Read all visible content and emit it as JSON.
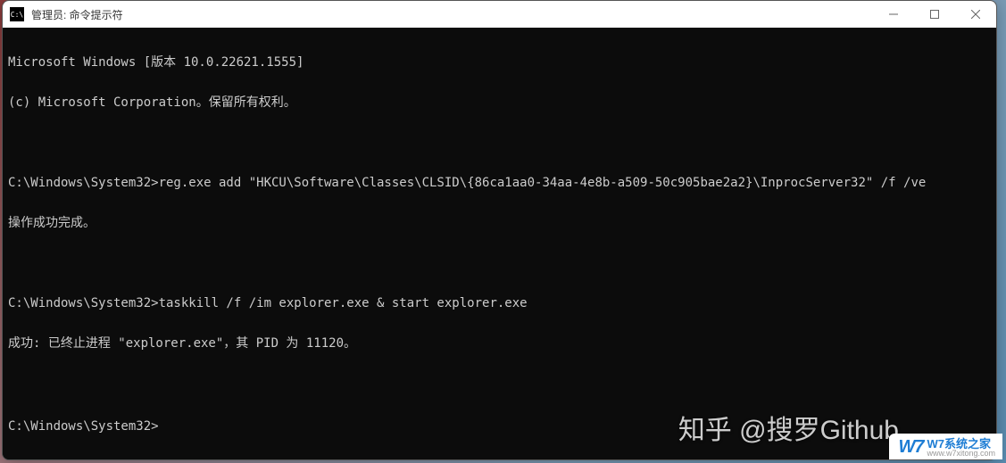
{
  "window": {
    "title": "管理员: 命令提示符"
  },
  "terminal": {
    "lines": [
      "Microsoft Windows [版本 10.0.22621.1555]",
      "(c) Microsoft Corporation。保留所有权利。",
      "",
      "C:\\Windows\\System32>reg.exe add \"HKCU\\Software\\Classes\\CLSID\\{86ca1aa0-34aa-4e8b-a509-50c905bae2a2}\\InprocServer32\" /f /ve",
      "操作成功完成。",
      "",
      "C:\\Windows\\System32>taskkill /f /im explorer.exe & start explorer.exe",
      "成功: 已终止进程 \"explorer.exe\"，其 PID 为 11120。",
      "",
      "C:\\Windows\\System32>"
    ]
  },
  "watermarks": {
    "zhihu": "知乎 @搜罗Github",
    "w7_logo": "W7",
    "w7_title": "W7系统之家",
    "w7_url": "www.w7xitong.com"
  }
}
